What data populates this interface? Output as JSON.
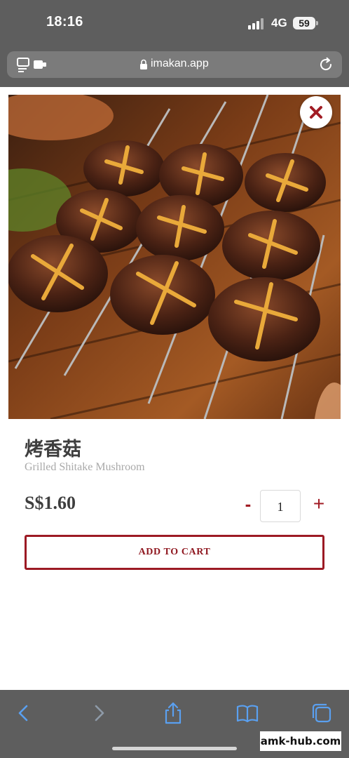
{
  "status_bar": {
    "time": "18:16",
    "network": "4G",
    "battery": "59"
  },
  "browser": {
    "url": "imakan.app",
    "icons": [
      "tabs-overview-icon",
      "lock-icon",
      "reload-icon"
    ]
  },
  "product": {
    "name_cn": "烤香菇",
    "name_en": "Grilled Shitake Mushroom",
    "price": "S$1.60",
    "quantity": "1",
    "decrement_label": "-",
    "increment_label": "+",
    "add_to_cart_label": "ADD TO CART",
    "image_icon": "close-icon"
  },
  "toolbar": {
    "icons": [
      "back-icon",
      "forward-icon",
      "share-icon",
      "bookmarks-icon",
      "tabs-icon"
    ]
  },
  "watermark": "amk-hub.com",
  "colors": {
    "accent": "#9c1a24",
    "browser_chrome": "#5e5e5e",
    "toolbar_icon": "#5aa0f0",
    "text_dark": "#3e3e3e",
    "text_muted": "#a9a9a9"
  }
}
